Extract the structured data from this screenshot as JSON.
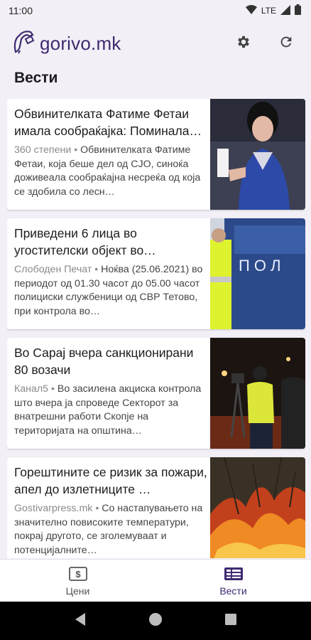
{
  "status_bar": {
    "time": "11:00",
    "network": "LTE"
  },
  "app_bar": {
    "brand": "gorivo.mk"
  },
  "section_title": "Вести",
  "articles": [
    {
      "title": "Обвинителката Фатиме Фетаи имала сообраќајка: Поминала…",
      "source": "360 степени",
      "date": "",
      "snippet": "Обвинителката Фатиме Фетаи, која беше дел од СЈО, синоќа доживеала сообраќајна несреќа од која се здобила со лесн…"
    },
    {
      "title": "Приведени 6 лица во угостителски објект во…",
      "source": "Слободен Печат",
      "date": "Ноќва (25.06.2021)",
      "snippet": "во периодот од 01.30 часот до 05.00 часот полициски службеници од СВР Тетово, при контрола во…"
    },
    {
      "title": "Во Сарај вчера санкционирани 80 возачи",
      "source": "Канал5",
      "date": "",
      "snippet": "Во засилена акциска контрола што вчера ја спроведе Секторот за внатрешни работи Скопје на територијата на општина…"
    },
    {
      "title": "Горештините се ризик за пожари, апел до излетниците …",
      "source": "Gostivarpress.mk",
      "date": "",
      "snippet": "Со настапувањето на значително повисоките температури, покрај другото, се зголемуваат и потенцијалните…"
    }
  ],
  "bottom_nav": {
    "prices_label": "Цени",
    "news_label": "Вести"
  },
  "colors": {
    "accent": "#3f2a70",
    "background": "#f2eff6"
  }
}
